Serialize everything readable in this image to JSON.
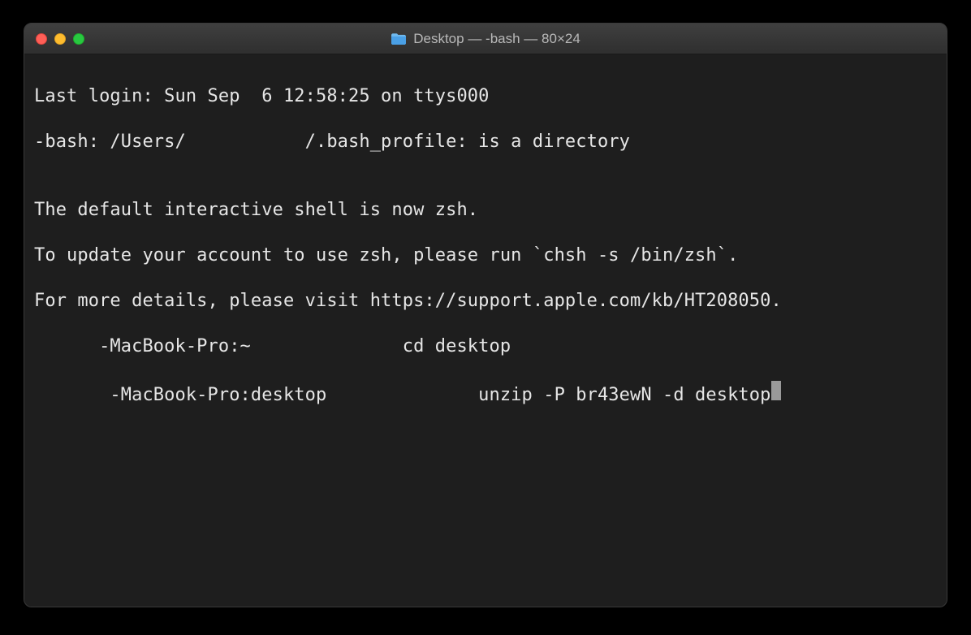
{
  "titlebar": {
    "title_folder": "Desktop",
    "title_sep1": " — ",
    "title_proc": "-bash",
    "title_sep2": " — ",
    "title_size": "80×24"
  },
  "terminal": {
    "line1": "Last login: Sun Sep  6 12:58:25 on ttys000",
    "line2": "-bash: /Users/           /.bash_profile: is a directory",
    "line3": "",
    "line4": "The default interactive shell is now zsh.",
    "line5": "To update your account to use zsh, please run `chsh -s /bin/zsh`.",
    "line6": "For more details, please visit https://support.apple.com/kb/HT208050.",
    "line7": "      -MacBook-Pro:~              cd desktop",
    "line8_prompt": "       -MacBook-Pro:desktop              unzip -P br43ewN -d desktop"
  }
}
